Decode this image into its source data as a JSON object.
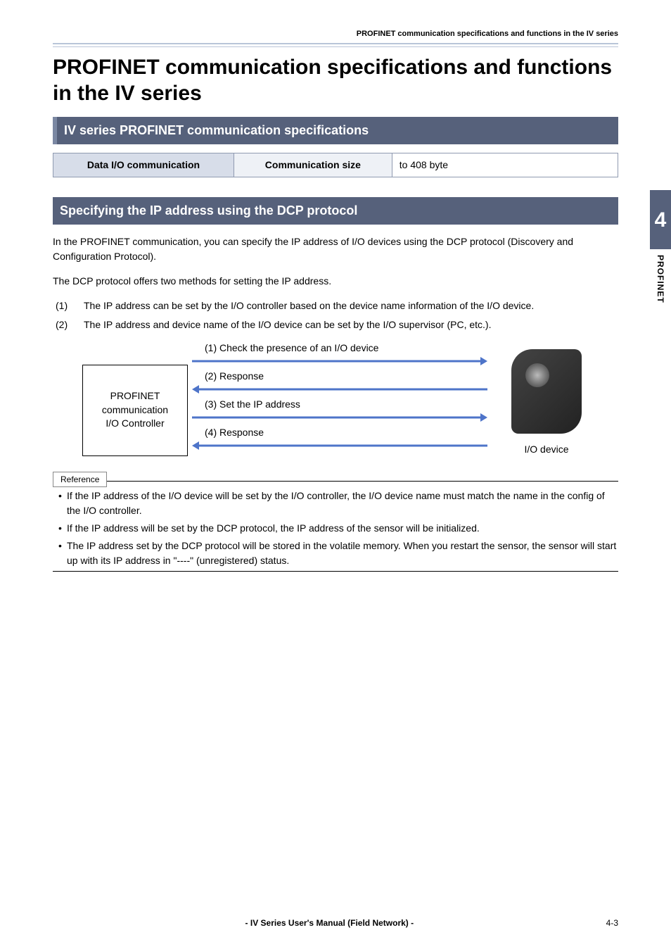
{
  "header_running": "PROFINET communication specifications and functions in the IV series",
  "title": "PROFINET communication specifications and functions in the IV series",
  "section1_title": "IV series PROFINET communication specifications",
  "spectable": {
    "r1c1": "Data I/O communication",
    "r1c2": "Communication size",
    "r1c3": "to 408 byte"
  },
  "section2_title": "Specifying the IP address using the DCP protocol",
  "para1": "In the PROFINET communication, you can specify the IP address of I/O devices using the DCP protocol (Discovery and Configuration Protocol).",
  "para2": "The DCP protocol offers two methods for setting the IP address.",
  "list": {
    "i1_num": "(1)",
    "i1": "The IP address can be set by the I/O controller based on the device name information of the I/O device.",
    "i2_num": "(2)",
    "i2": "The IP address and device name of the I/O device can be set by the I/O supervisor (PC, etc.)."
  },
  "diagram": {
    "ctrl_line1": "PROFINET",
    "ctrl_line2": "communication",
    "ctrl_line3": "I/O Controller",
    "a1": "(1) Check the presence of an I/O device",
    "a2": "(2) Response",
    "a3": "(3) Set the IP address",
    "a4": "(4) Response",
    "device_label": "I/O device"
  },
  "reference_label": "Reference",
  "reference_items": {
    "r1": "If the IP address of the I/O device will be set by the I/O controller, the I/O device name must match the name in the config of the I/O controller.",
    "r2": "If the IP address will be set by the DCP protocol, the IP address of the sensor will be initialized.",
    "r3": "The IP address set by the DCP protocol will be stored in the volatile memory. When you restart the sensor, the sensor will start up with its IP address in \"----\" (unregistered) status."
  },
  "sidetab": {
    "num": "4",
    "text": "PROFINET"
  },
  "footer": {
    "center": "- IV Series User's Manual (Field Network) -",
    "right": "4-3"
  }
}
